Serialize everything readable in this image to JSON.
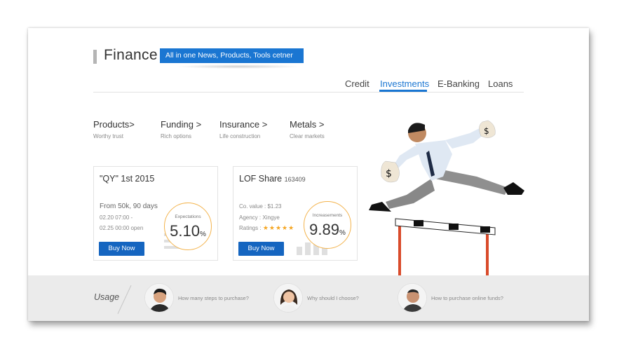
{
  "header": {
    "title": "Finance",
    "tagline": "All in one News, Products, Tools cetner"
  },
  "nav": {
    "items": [
      {
        "label": "Credit",
        "active": false
      },
      {
        "label": "Investments",
        "active": true
      },
      {
        "label": "E-Banking",
        "active": false
      },
      {
        "label": "Loans",
        "active": false
      }
    ]
  },
  "categories": [
    {
      "title": "Products>",
      "subtitle": "Worthy trust"
    },
    {
      "title": "Funding >",
      "subtitle": "Rich options"
    },
    {
      "title": "Insurance >",
      "subtitle": "Life construction"
    },
    {
      "title": "Metals >",
      "subtitle": "Clear markets"
    }
  ],
  "products": [
    {
      "title": "\"QY\"  1st 2015",
      "line1": "From 50k, 90 days",
      "line2": "02.20 07:00 -",
      "line3": "02.25 00:00 open",
      "ring_label": "Expectations",
      "ring_value": "5.10",
      "ring_unit": "%",
      "button": "Buy Now"
    },
    {
      "title": "LOF Share",
      "code": "163409",
      "line1": "Co. value : $1.23",
      "line2": "Agency : Xingye",
      "line3_label": "Ratings :",
      "rating": 5,
      "stars": "★★★★★",
      "ring_label": "Increasements",
      "ring_value": "9.89",
      "ring_unit": "%",
      "button": "Buy Now"
    }
  ],
  "usage": {
    "label": "Usage",
    "questions": [
      {
        "text": "How many steps to purchase?",
        "avatar": "male-avatar"
      },
      {
        "text": "Why should I choose?",
        "avatar": "female-avatar"
      },
      {
        "text": "How to purchase online funds?",
        "avatar": "older-male-avatar"
      }
    ]
  },
  "colors": {
    "accent": "#1a76d2",
    "button": "#1565c0",
    "ring": "#f3b34c",
    "stars": "#f5a623",
    "footer_bg": "#ebebeb"
  }
}
